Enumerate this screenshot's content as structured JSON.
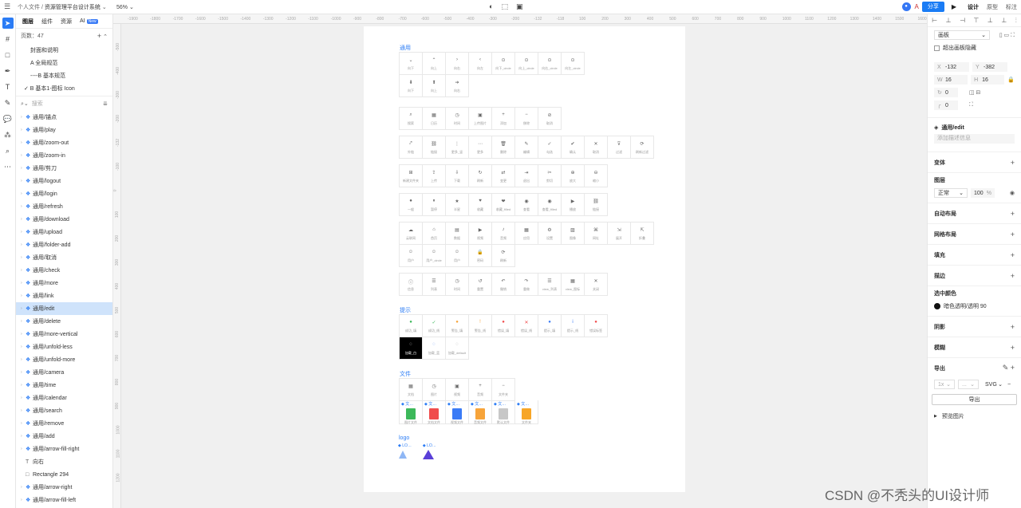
{
  "topbar": {
    "breadcrumb_root": "个人文件",
    "separator": "/",
    "project": "资源管理平台设计系统",
    "zoom": "56%",
    "share": "分享",
    "modes": [
      "设计",
      "原型",
      "标注"
    ]
  },
  "left_panel": {
    "tabs": [
      "图层",
      "组件",
      "资源",
      "AI"
    ],
    "ai_badge": "New",
    "pages_count": "页数：47",
    "pages": [
      "封面和说明",
      "A 全局规范",
      "----B 基本规范",
      "B 基本1-图标 Icon"
    ],
    "current_page_index": 3,
    "search_placeholder": "搜索",
    "layers": [
      "通用/锚点",
      "通用/play",
      "通用/zoom-out",
      "通用/zoom-in",
      "通用/剪刀",
      "通用/logout",
      "通用/login",
      "通用/refresh",
      "通用/download",
      "通用/upload",
      "通用/folder-add",
      "通用/取消",
      "通用/check",
      "通用/more",
      "通用/link",
      "通用/edit",
      "通用/delete",
      "通用/more-vertical",
      "通用/unfold-less",
      "通用/unfold-more",
      "通用/camera",
      "通用/time",
      "通用/calendar",
      "通用/search",
      "通用/remove",
      "通用/add",
      "通用/arrow-fill-right",
      "向右",
      "Rectangle 294",
      "通用/arrow-right",
      "通用/arrow-fill-left"
    ],
    "selected_layer_index": 15
  },
  "ruler": {
    "top": [
      "-1900",
      "-1800",
      "-1700",
      "-1600",
      "-1500",
      "-1400",
      "-1300",
      "-1200",
      "-1100",
      "-1000",
      "-900",
      "-800",
      "-700",
      "-600",
      "-500",
      "-400",
      "-300",
      "-200",
      "-132",
      "-118",
      "100",
      "200",
      "300",
      "400",
      "500",
      "600",
      "700",
      "800",
      "900",
      "1000",
      "1100",
      "1200",
      "1300",
      "1400",
      "1500",
      "1600"
    ],
    "left": [
      "-500",
      "-400",
      "-300",
      "-200",
      "-132",
      "-100",
      "0",
      "100",
      "200",
      "300",
      "400",
      "500",
      "600",
      "700",
      "800",
      "900",
      "1000",
      "1100",
      "1200"
    ]
  },
  "canvas": {
    "sections": {
      "general": "通用",
      "hint": "提示",
      "file": "文件",
      "logo": "logo"
    },
    "group1": [
      "向下",
      "向上",
      "向右",
      "向左",
      "向下_circle",
      "向上_circle",
      "向右_circle",
      "向左_circle",
      "向下",
      "向上",
      "向右"
    ],
    "group2": [
      "搜索",
      "日历",
      "时间",
      "上传图片",
      "添加",
      "移除",
      "取消"
    ],
    "group3": [
      "外链",
      "链接",
      "更多_竖",
      "更多",
      "删除",
      "编辑",
      "勾选",
      "确认",
      "取消",
      "过滤",
      "刷新过滤"
    ],
    "group4": [
      "新建文件夹",
      "上传",
      "下载",
      "刷新",
      "变更",
      "退出",
      "剪切",
      "放大",
      "缩小"
    ],
    "group5": [
      "一般",
      "暂停",
      "半星",
      "收藏",
      "收藏_filled",
      "查看",
      "查看_filled",
      "播放",
      "链接"
    ],
    "group6": [
      "云联网",
      "首页",
      "数据",
      "视频",
      "音频",
      "应用",
      "设置",
      "图像",
      "网址",
      "展开",
      "折叠",
      "用户",
      "用户_circle",
      "用户",
      "密码",
      "刷新"
    ],
    "group7": [
      "信息",
      "列表",
      "时间",
      "重置",
      "撤销",
      "重做",
      "view_列表",
      "view_图标",
      "关闭"
    ],
    "hints": [
      "成功_填",
      "成功_线",
      "警告_填",
      "警告_线",
      "错误_填",
      "错误_线",
      "提示_填",
      "提示_线",
      "错误标签",
      "加载_白",
      "加载_蓝",
      "加载_default"
    ],
    "files_icons": [
      "文档",
      "图片",
      "视频",
      "音频",
      "文件夹"
    ],
    "files_colored": [
      {
        "tag": "文…",
        "label": "图片文件",
        "color": "#3cb85a"
      },
      {
        "tag": "文…",
        "label": "文档文件",
        "color": "#f04c4c"
      },
      {
        "tag": "文…",
        "label": "视频文件",
        "color": "#3a7bf6"
      },
      {
        "tag": "文…",
        "label": "音频文件",
        "color": "#f7a43a"
      },
      {
        "tag": "文…",
        "label": "默认文件",
        "color": "#c7c7c7"
      },
      {
        "tag": "文…",
        "label": "文件夹",
        "color": "#f7a627"
      }
    ],
    "logo_tags": [
      "LO…",
      "LO…"
    ]
  },
  "right_panel": {
    "frame_type": "画板",
    "clip": "超出画板隐藏",
    "x_label": "X",
    "x": "-132",
    "y_label": "Y",
    "y": "-382",
    "w_label": "W",
    "w": "16",
    "h_label": "H",
    "h": "16",
    "rotation": "0",
    "radius": "0",
    "component_name": "通用/edit",
    "description_placeholder": "添加描述信息",
    "sections": {
      "variants": "变体",
      "layer": "图层",
      "autolayout": "自动布局",
      "gridlayout": "网格布局",
      "fill": "填充",
      "stroke": "描边",
      "selected_colors": "选中颜色",
      "shadow": "阴影",
      "blur": "模糊",
      "export": "导出"
    },
    "blend": "正常",
    "opacity": "100",
    "opacity_unit": "%",
    "selected_color_name": "暗色透明/透明 90",
    "export_scale": "1x",
    "export_suffix": "...",
    "export_format": "SVG",
    "export_button": "导出",
    "preview": "预览图片"
  },
  "watermark": "CSDN @不秃头的UI设计师"
}
